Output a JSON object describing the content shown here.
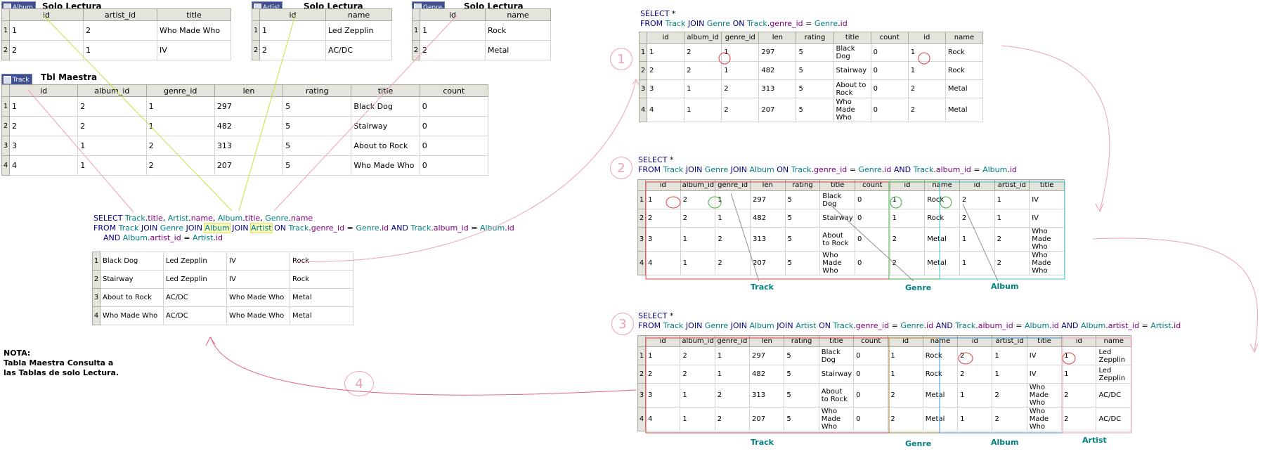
{
  "album": {
    "badge": "Album",
    "title": "Solo Lectura",
    "columns": [
      "id",
      "artist_id",
      "title"
    ],
    "rows": [
      [
        "1",
        "1",
        "2",
        "Who Made Who"
      ],
      [
        "2",
        "2",
        "1",
        "IV"
      ]
    ]
  },
  "artist": {
    "badge": "Artist",
    "title": "Solo Lectura",
    "columns": [
      "id",
      "name"
    ],
    "rows": [
      [
        "1",
        "1",
        "Led Zepplin"
      ],
      [
        "2",
        "2",
        "AC/DC"
      ]
    ]
  },
  "genre": {
    "badge": "Genre",
    "title": "Solo Lectura",
    "columns": [
      "id",
      "name"
    ],
    "rows": [
      [
        "1",
        "1",
        "Rock"
      ],
      [
        "2",
        "2",
        "Metal"
      ]
    ]
  },
  "track": {
    "badge": "Track",
    "title": "Tbl Maestra",
    "columns": [
      "id",
      "album_id",
      "genre_id",
      "len",
      "rating",
      "title",
      "count"
    ],
    "rows": [
      [
        "1",
        "1",
        "2",
        "1",
        "297",
        "5",
        "Black Dog",
        "0"
      ],
      [
        "2",
        "2",
        "2",
        "1",
        "482",
        "5",
        "Stairway",
        "0"
      ],
      [
        "3",
        "3",
        "1",
        "2",
        "313",
        "5",
        "About to Rock",
        "0"
      ],
      [
        "4",
        "4",
        "1",
        "2",
        "207",
        "5",
        "Who Made Who",
        "0"
      ]
    ]
  },
  "query4": {
    "rows": [
      [
        "1",
        "Black Dog",
        "Led Zepplin",
        "IV",
        "Rock"
      ],
      [
        "2",
        "Stairway",
        "Led Zepplin",
        "IV",
        "Rock"
      ],
      [
        "3",
        "About to Rock",
        "AC/DC",
        "Who Made Who",
        "Metal"
      ],
      [
        "4",
        "Who Made Who",
        "AC/DC",
        "Who Made Who",
        "Metal"
      ]
    ]
  },
  "note": "NOTA:\nTabla Maestra Consulta a\nlas Tablas de solo Lectura.",
  "query1": {
    "number": "1",
    "columns": [
      "id",
      "album_id",
      "genre_id",
      "len",
      "rating",
      "title",
      "count",
      "id",
      "name"
    ],
    "rows": [
      [
        "1",
        "1",
        "2",
        "1",
        "297",
        "5",
        "Black Dog",
        "0",
        "1",
        "Rock"
      ],
      [
        "2",
        "2",
        "2",
        "1",
        "482",
        "5",
        "Stairway",
        "0",
        "1",
        "Rock"
      ],
      [
        "3",
        "3",
        "1",
        "2",
        "313",
        "5",
        "About to Rock",
        "0",
        "2",
        "Metal"
      ],
      [
        "4",
        "4",
        "1",
        "2",
        "207",
        "5",
        "Who Made Who",
        "0",
        "2",
        "Metal"
      ]
    ]
  },
  "query2": {
    "number": "2",
    "columns": [
      "id",
      "album_id",
      "genre_id",
      "len",
      "rating",
      "title",
      "count",
      "id",
      "name",
      "id",
      "artist_id",
      "title"
    ],
    "rows": [
      [
        "1",
        "1",
        "2",
        "1",
        "297",
        "5",
        "Black Dog",
        "0",
        "1",
        "Rock",
        "2",
        "1",
        "IV"
      ],
      [
        "2",
        "2",
        "2",
        "1",
        "482",
        "5",
        "Stairway",
        "0",
        "1",
        "Rock",
        "2",
        "1",
        "IV"
      ],
      [
        "3",
        "3",
        "1",
        "2",
        "313",
        "5",
        "About to Rock",
        "0",
        "2",
        "Metal",
        "1",
        "2",
        "Who Made Who"
      ],
      [
        "4",
        "4",
        "1",
        "2",
        "207",
        "5",
        "Who Made Who",
        "0",
        "2",
        "Metal",
        "1",
        "2",
        "Who Made Who"
      ]
    ],
    "labels": [
      "Track",
      "Genre",
      "Album"
    ]
  },
  "query3": {
    "number": "3",
    "columns": [
      "id",
      "album_id",
      "genre_id",
      "len",
      "rating",
      "title",
      "count",
      "id",
      "name",
      "id",
      "artist_id",
      "title",
      "id",
      "name"
    ],
    "rows": [
      [
        "1",
        "1",
        "2",
        "1",
        "297",
        "5",
        "Black Dog",
        "0",
        "1",
        "Rock",
        "2",
        "1",
        "IV",
        "1",
        "Led Zepplin"
      ],
      [
        "2",
        "2",
        "2",
        "1",
        "482",
        "5",
        "Stairway",
        "0",
        "1",
        "Rock",
        "2",
        "1",
        "IV",
        "1",
        "Led Zepplin"
      ],
      [
        "3",
        "3",
        "1",
        "2",
        "313",
        "5",
        "About to Rock",
        "0",
        "2",
        "Metal",
        "1",
        "2",
        "Who Made Who",
        "2",
        "AC/DC"
      ],
      [
        "4",
        "4",
        "1",
        "2",
        "207",
        "5",
        "Who Made Who",
        "0",
        "2",
        "Metal",
        "1",
        "2",
        "Who Made Who",
        "2",
        "AC/DC"
      ]
    ],
    "labels": [
      "Track",
      "Genre",
      "Album",
      "Artist"
    ]
  },
  "number4": "4",
  "sql": {
    "select": "SELECT",
    "from": "FROM",
    "join": "JOIN",
    "on": "ON",
    "and": "AND",
    "star": "*",
    "eq": "=",
    "comma": ",",
    "dot": ".",
    "t_track": "Track",
    "t_genre": "Genre",
    "t_album": "Album",
    "t_artist": "Artist",
    "c_title": "title",
    "c_name": "name",
    "c_genre_id": "genre_id",
    "c_album_id": "album_id",
    "c_artist_id": "artist_id",
    "c_id": "id"
  },
  "colors": {
    "pink": "#f0a0b8",
    "lime": "#c8e040",
    "red": "#e04040",
    "green": "#40b040",
    "blue": "#4090d0",
    "teal": "#008080"
  }
}
